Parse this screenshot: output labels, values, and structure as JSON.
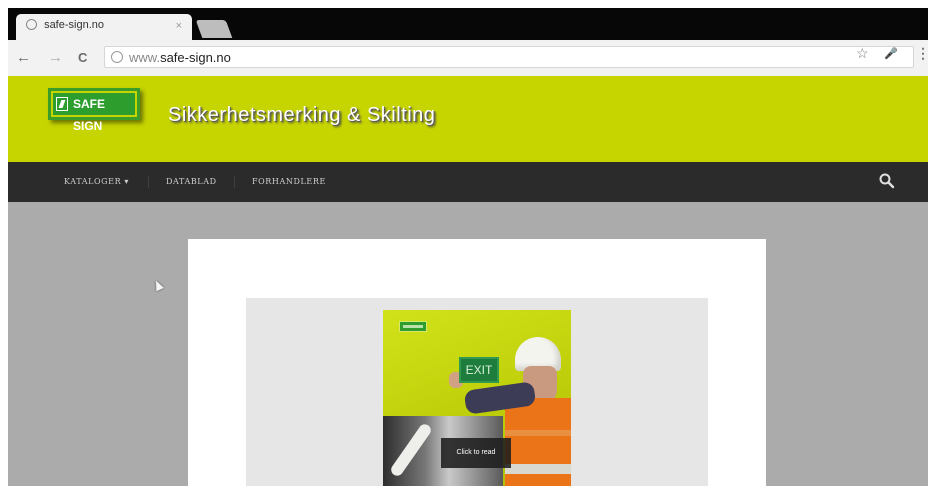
{
  "browser": {
    "tab_title": "safe-sign.no",
    "tab_close": "×",
    "url_prefix": "www.",
    "url_domain": "safe-sign.no",
    "back_glyph": "←",
    "forward_glyph": "→",
    "reload_glyph": "C",
    "star_glyph": "☆",
    "mic_glyph": "🎤",
    "menu_glyph": "⋮"
  },
  "site": {
    "logo_text": "SAFE SIGN",
    "title": "Sikkerhetsmerking & Skilting",
    "nav": [
      {
        "label": "KATALOGER",
        "dropdown": "▾"
      },
      {
        "label": "DATABLAD"
      },
      {
        "label": "FORHANDLERE"
      }
    ],
    "brand_color": "#c6d400",
    "navbar_color": "#2b2b2b"
  },
  "viewer": {
    "cover_sign_text": "EXIT",
    "click_to_read": "Click to read"
  }
}
